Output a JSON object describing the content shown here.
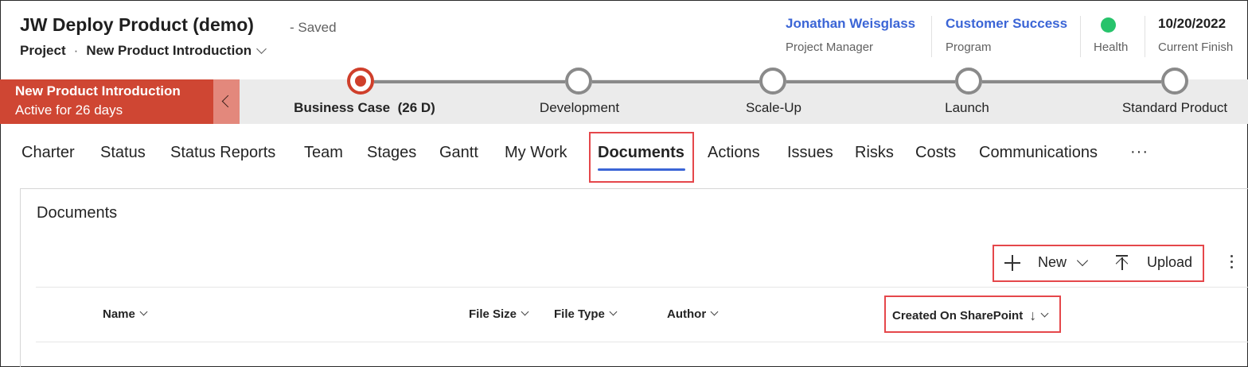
{
  "header": {
    "title": "JW Deploy Product (demo)",
    "saved_status": "- Saved",
    "entity_type": "Project",
    "separator": "·",
    "process_name": "New Product Introduction",
    "meta": [
      {
        "value": "Jonathan Weisglass",
        "label": "Project Manager"
      },
      {
        "value": "Customer Success",
        "label": "Program"
      },
      {
        "value": "",
        "label": "Health",
        "status_color": "#27c36b"
      },
      {
        "value": "10/20/2022",
        "label": "Current Finish"
      }
    ]
  },
  "process": {
    "active_title": "New Product Introduction",
    "active_duration": "Active for 26 days",
    "stages": [
      {
        "label": "Business Case",
        "duration": "(26 D)",
        "active": true
      },
      {
        "label": "Development"
      },
      {
        "label": "Scale-Up"
      },
      {
        "label": "Launch"
      },
      {
        "label": "Standard Product"
      }
    ]
  },
  "tabs": {
    "items": [
      "Charter",
      "Status",
      "Status Reports",
      "Team",
      "Stages",
      "Gantt",
      "My Work",
      "Documents",
      "Actions",
      "Issues",
      "Risks",
      "Costs",
      "Communications"
    ],
    "selected": "Documents",
    "more": "···"
  },
  "documents": {
    "title": "Documents",
    "commands": {
      "new_label": "New",
      "upload_label": "Upload"
    },
    "columns": [
      "Name",
      "File Size",
      "File Type",
      "Author",
      "Created On SharePoint"
    ],
    "sort_indicator": "↓"
  },
  "colors": {
    "accent": "#3b65d6",
    "active_stage": "#cf4633",
    "highlight": "#e5474b"
  }
}
